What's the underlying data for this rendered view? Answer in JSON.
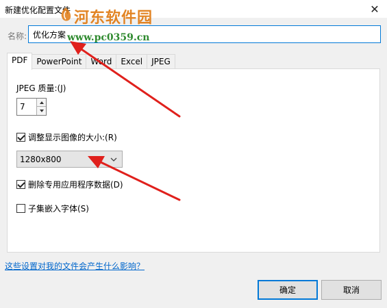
{
  "window": {
    "title": "新建优化配置文件",
    "close_glyph": "✕"
  },
  "watermark": {
    "brand": "河东软件园",
    "url": "www.pc0359.cn"
  },
  "name_field": {
    "label": "名称:",
    "value": "优化方案"
  },
  "tabs": [
    {
      "label": "PDF",
      "active": true
    },
    {
      "label": "PowerPoint",
      "active": false
    },
    {
      "label": "Word",
      "active": false
    },
    {
      "label": "Excel",
      "active": false
    },
    {
      "label": "JPEG",
      "active": false
    }
  ],
  "pdf_panel": {
    "jpeg_quality_label": "JPEG 质量:(J)",
    "jpeg_quality_value": "7",
    "resize_label": "调整显示图像的大小:(R)",
    "resize_checked": true,
    "resolution_value": "1280x800",
    "delete_app_data_label": "删除专用应用程序数据(D)",
    "delete_app_data_checked": true,
    "embed_subset_label": "子集嵌入字体(S)",
    "embed_subset_checked": false
  },
  "help_link": "这些设置对我的文件会产生什么影响？",
  "buttons": {
    "ok": "确定",
    "cancel": "取消"
  },
  "colors": {
    "accent": "#0078d7",
    "annotation_arrow": "#e0201c",
    "link": "#0066cc"
  },
  "icons": {
    "close": "close-icon",
    "spin_up": "triangle-up-icon",
    "spin_down": "triangle-down-icon",
    "dropdown": "chevron-down-icon",
    "check": "checkmark-icon"
  }
}
